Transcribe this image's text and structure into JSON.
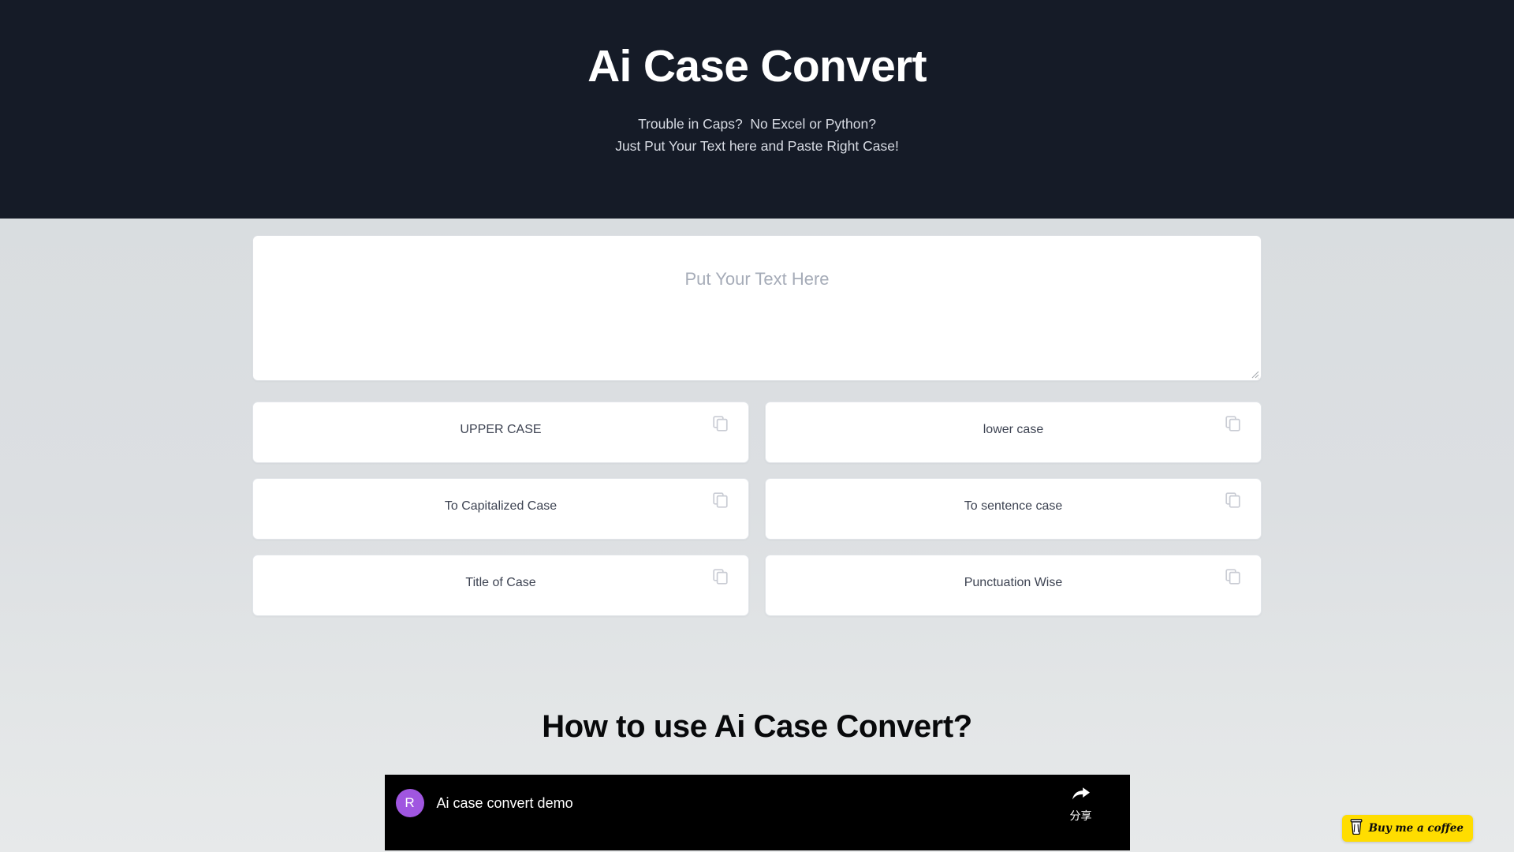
{
  "hero": {
    "title": "Ai Case Convert",
    "subtitle_line1": "Trouble in Caps?  No Excel or Python?",
    "subtitle_line2": "Just Put Your Text here and Paste Right Case!",
    "background_color": "#151b27"
  },
  "editor": {
    "placeholder": "Put Your Text Here",
    "value": "",
    "resize_handle": "resize-grip-icon"
  },
  "cards": [
    {
      "label": "UPPER CASE",
      "copy_icon": "copy-icon"
    },
    {
      "label": "lower case",
      "copy_icon": "copy-icon"
    },
    {
      "label": "To Capitalized Case",
      "copy_icon": "copy-icon"
    },
    {
      "label": "To sentence case",
      "copy_icon": "copy-icon"
    },
    {
      "label": "Title of Case",
      "copy_icon": "copy-icon"
    },
    {
      "label": "Punctuation Wise",
      "copy_icon": "copy-icon"
    }
  ],
  "howto": {
    "title": "How to use Ai Case Convert?"
  },
  "player": {
    "avatar_initial": "R",
    "video_title": "Ai case convert demo",
    "share_label": "分享",
    "share_icon": "share-arrow-icon"
  },
  "bmc": {
    "label": "Buy me a coffee",
    "icon": "coffee-cup-icon",
    "color": "#ffdd00"
  }
}
